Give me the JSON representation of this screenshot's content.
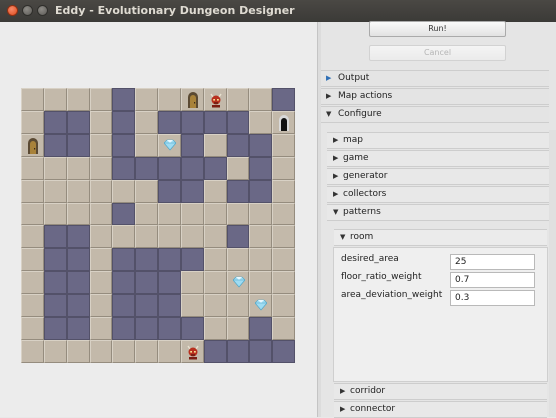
{
  "window": {
    "title": "Eddy - Evolutionary Dungeon Designer"
  },
  "colors": {
    "floor": "#c3b9aa",
    "wall": "#6a6886",
    "accent": "#2f6fb5"
  },
  "map": {
    "legend": {
      "f": "floor",
      "w": "wall",
      "d": "door",
      "x": "dark doorway",
      "e": "enemy",
      "t": "treasure"
    },
    "rows": [
      "ffffwffdeffw",
      "fwwfwfwwwwfx",
      "dwwfwftwfwwf",
      "ffffwwwwwfwf",
      "ffffffwwfwwf",
      "ffffwfffffff",
      "fwwffffffwff",
      "fwwfwwwwffff",
      "fwwfwwwfftff",
      "fwwfwwwffftf",
      "fwwfwwwwffwf",
      "fffffffewwww"
    ]
  },
  "controls": {
    "run_label": "Run!",
    "cancel_label": "Cancel"
  },
  "sections": {
    "output": "Output",
    "map_actions": "Map actions",
    "configure": "Configure"
  },
  "configure": {
    "map": "map",
    "game": "game",
    "generator": "generator",
    "collectors": "collectors",
    "patterns": "patterns",
    "room": "room",
    "corridor": "corridor",
    "connector": "connector"
  },
  "room_params": [
    {
      "label": "desired_area",
      "value": "25"
    },
    {
      "label": "floor_ratio_weight",
      "value": "0.7"
    },
    {
      "label": "area_deviation_weight",
      "value": "0.3"
    }
  ]
}
